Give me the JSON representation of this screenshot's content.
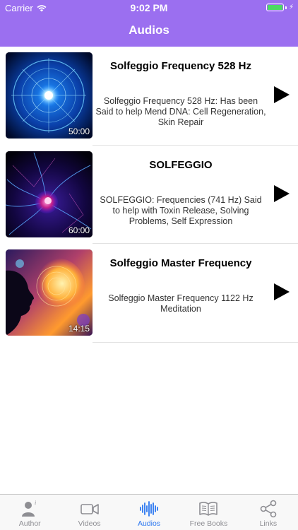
{
  "status_bar": {
    "carrier": "Carrier",
    "time": "9:02 PM"
  },
  "nav": {
    "title": "Audios"
  },
  "items": [
    {
      "title": "Solfeggio Frequency 528 Hz",
      "description": "Solfeggio Frequency 528 Hz: Has been Said to help Mend DNA: Cell Regeneration, Skin Repair",
      "duration": "50:00"
    },
    {
      "title": "SOLFEGGIO",
      "description": "SOLFEGGIO: Frequencies (741 Hz) Said to help with Toxin Release, Solving Problems, Self Expression",
      "duration": "60:00"
    },
    {
      "title": "Solfeggio Master Frequency",
      "description": "Solfeggio Master Frequency 1122 Hz Meditation",
      "duration": "14:15"
    }
  ],
  "tabs": [
    {
      "label": "Author",
      "icon": "author-icon"
    },
    {
      "label": "Videos",
      "icon": "video-camera-icon"
    },
    {
      "label": "Audios",
      "icon": "audio-wave-icon",
      "active": true
    },
    {
      "label": "Free Books",
      "icon": "book-icon"
    },
    {
      "label": "Links",
      "icon": "share-icon"
    }
  ],
  "colors": {
    "nav_background": "#9b6ff0",
    "tab_active": "#2a76f0",
    "tab_inactive": "#8e8e93"
  }
}
